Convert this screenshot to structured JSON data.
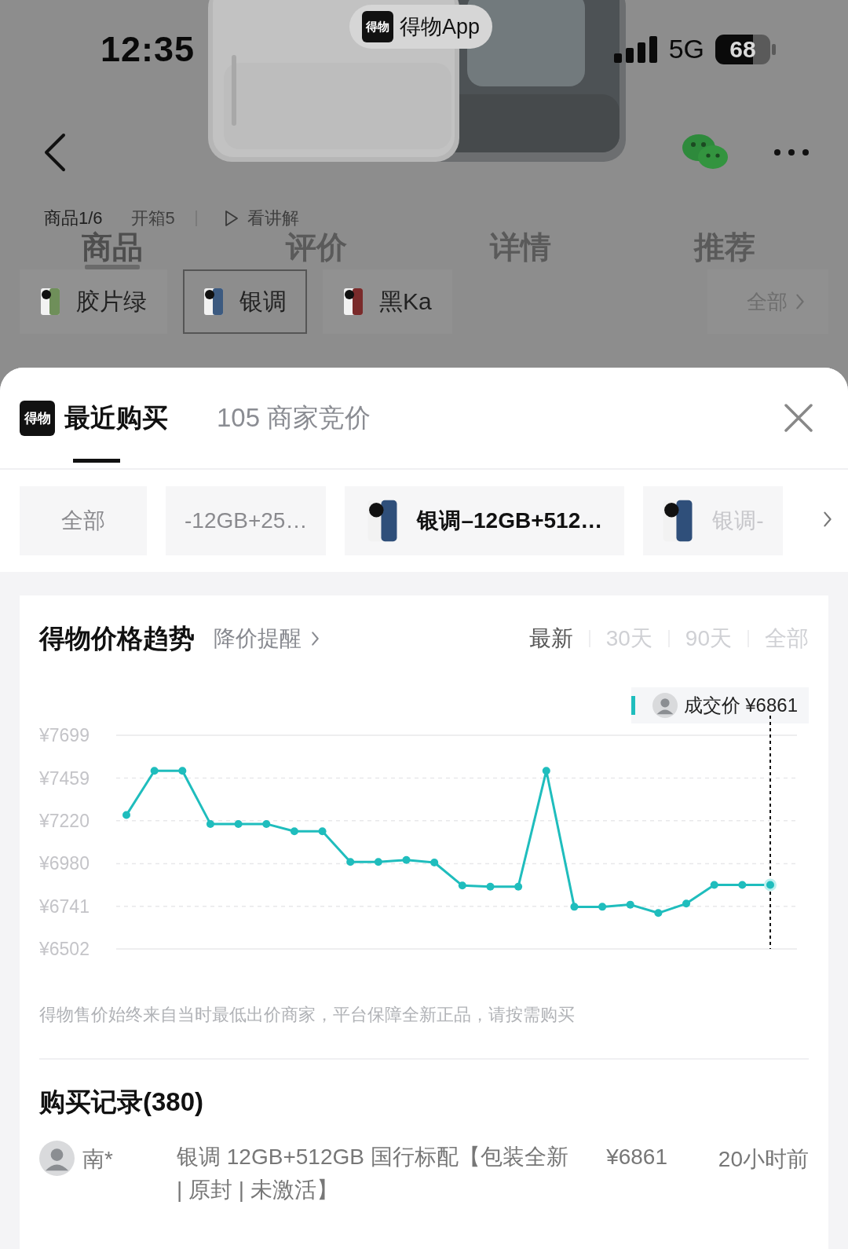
{
  "status_bar": {
    "time": "12:35",
    "app_pill": {
      "logo": "得物",
      "label": "得物App"
    },
    "network": "5G",
    "battery": "68"
  },
  "media_tabs": [
    {
      "label": "商品1/6",
      "selected": true,
      "kind": "plain"
    },
    {
      "label": "开箱5",
      "selected": false,
      "kind": "plain"
    },
    {
      "label": "看讲解",
      "selected": false,
      "kind": "video"
    }
  ],
  "section_tabs": [
    {
      "label": "商品",
      "selected": true
    },
    {
      "label": "评价",
      "selected": false
    },
    {
      "label": "详情",
      "selected": false
    },
    {
      "label": "推荐",
      "selected": false
    }
  ],
  "variants": [
    {
      "label": "胶片绿",
      "selected": false,
      "color": "#6f8f5a"
    },
    {
      "label": "银调",
      "selected": true,
      "color": "#3c5a80"
    },
    {
      "label": "黑Ka",
      "selected": false,
      "color": "#7a2b2b"
    }
  ],
  "variants_more": "全部",
  "sheet": {
    "tabs": [
      {
        "label": "最近购买",
        "selected": true,
        "logo": "得物"
      },
      {
        "label": "105 商家竞价",
        "selected": false
      }
    ],
    "filters": [
      {
        "label": "全部",
        "selected": false,
        "thumbnail": false
      },
      {
        "label": "-12GB+25…",
        "selected": false,
        "thumbnail": false
      },
      {
        "label": "银调–12GB+512…",
        "selected": true,
        "thumbnail": true
      },
      {
        "label": "银调-",
        "selected": false,
        "thumbnail": true
      }
    ],
    "price_trend": {
      "title": "得物价格趋势",
      "alert_link": "降价提醒",
      "ranges": [
        {
          "label": "最新",
          "selected": true
        },
        {
          "label": "30天",
          "selected": false
        },
        {
          "label": "90天",
          "selected": false
        },
        {
          "label": "全部",
          "selected": false
        }
      ],
      "tooltip_value": "¥6861",
      "chart_data": {
        "type": "line",
        "grid": true,
        "ylim": [
          6502,
          7699
        ],
        "yticks": [
          {
            "value": 7699,
            "label": "¥7699"
          },
          {
            "value": 7459,
            "label": "¥7459"
          },
          {
            "value": 7220,
            "label": "¥7220"
          },
          {
            "value": 6980,
            "label": "¥6980"
          },
          {
            "value": 6741,
            "label": "¥6741"
          },
          {
            "value": 6502,
            "label": "¥6502"
          }
        ],
        "series": [
          {
            "name": "成交价",
            "color": "#1fbdbd",
            "marker": true,
            "values": [
              7252,
              7500,
              7500,
              7202,
              7202,
              7202,
              7161,
              7161,
              6989,
              6989,
              7000,
              6986,
              6857,
              6851,
              6851,
              7500,
              6738,
              6738,
              6750,
              6703,
              6756,
              6861,
              6861,
              6861
            ]
          }
        ]
      },
      "note": "得物售价始终来自当时最低出价商家，平台保障全新正品，请按需购买"
    }
  },
  "records": {
    "title": "购买记录(380)",
    "rows": [
      {
        "user": "南*",
        "item": "银调 12GB+512GB 国行标配【包装全新 | 原封 | 未激活】",
        "price": "¥6861",
        "time": "20小时前"
      }
    ]
  }
}
